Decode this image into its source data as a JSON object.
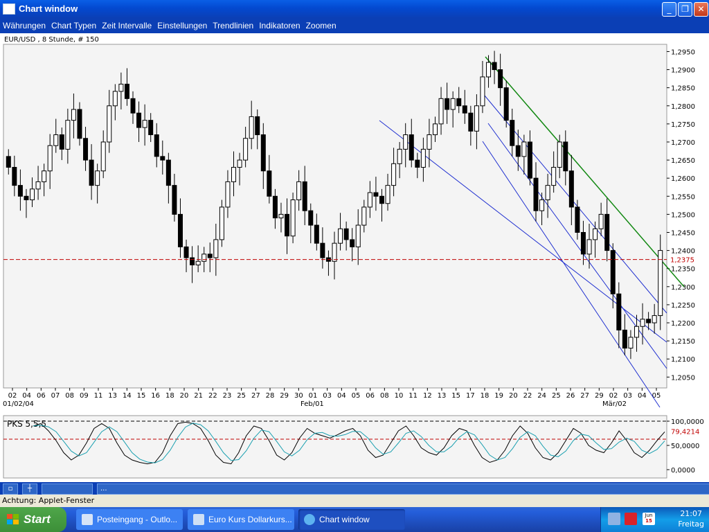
{
  "window": {
    "title": "Chart window"
  },
  "menu": [
    "Währungen",
    "Chart Typen",
    "Zeit Intervalle",
    "Einstellungen",
    "Trendlinien",
    "Indikatoren",
    "Zoomen"
  ],
  "chart_data": {
    "type": "candlestick",
    "title": "EUR/USD , 8 Stunde, # 150",
    "ylim": [
      1.202,
      1.297
    ],
    "y_ticks": [
      "1,2950",
      "1,2900",
      "1,2850",
      "1,2800",
      "1,2750",
      "1,2700",
      "1,2650",
      "1,2600",
      "1,2550",
      "1,2500",
      "1,2450",
      "1,2400",
      "1,2350",
      "1,2300",
      "1,2250",
      "1,2200",
      "1,2150",
      "1,2100",
      "1,2050"
    ],
    "x_ticks": [
      "02",
      "04",
      "06",
      "07",
      "08",
      "09",
      "11",
      "13",
      "14",
      "15",
      "16",
      "18",
      "20",
      "21",
      "22",
      "23",
      "25",
      "27",
      "28",
      "29",
      "30",
      "01",
      "03",
      "04",
      "05",
      "06",
      "08",
      "10",
      "11",
      "12",
      "13",
      "15",
      "17",
      "18",
      "19",
      "20",
      "22",
      "24",
      "25",
      "26",
      "27",
      "29",
      "02",
      "03",
      "04",
      "05"
    ],
    "x_date_labels": [
      "01/02/04",
      "Feb/01",
      "Mär/02"
    ],
    "current_price_label": "1,2375",
    "current_price": 1.2375,
    "closes": [
      1.263,
      1.258,
      1.255,
      1.254,
      1.257,
      1.259,
      1.262,
      1.269,
      1.272,
      1.268,
      1.276,
      1.279,
      1.271,
      1.265,
      1.258,
      1.262,
      1.27,
      1.28,
      1.284,
      1.286,
      1.282,
      1.278,
      1.274,
      1.276,
      1.272,
      1.266,
      1.265,
      1.258,
      1.25,
      1.241,
      1.238,
      1.236,
      1.237,
      1.239,
      1.238,
      1.243,
      1.252,
      1.259,
      1.263,
      1.265,
      1.271,
      1.277,
      1.272,
      1.262,
      1.255,
      1.249,
      1.25,
      1.244,
      1.254,
      1.259,
      1.251,
      1.247,
      1.242,
      1.238,
      1.237,
      1.242,
      1.246,
      1.243,
      1.241,
      1.247,
      1.252,
      1.256,
      1.255,
      1.253,
      1.258,
      1.264,
      1.268,
      1.272,
      1.265,
      1.263,
      1.268,
      1.272,
      1.275,
      1.282,
      1.279,
      1.282,
      1.28,
      1.278,
      1.273,
      1.28,
      1.288,
      1.292,
      1.29,
      1.285,
      1.276,
      1.269,
      1.266,
      1.27,
      1.26,
      1.251,
      1.254,
      1.258,
      1.263,
      1.27,
      1.262,
      1.252,
      1.245,
      1.239,
      1.243,
      1.246,
      1.25,
      1.24,
      1.228,
      1.218,
      1.213,
      1.216,
      1.219,
      1.221,
      1.22,
      1.222,
      1.24
    ],
    "annotations": [
      "blue downward trend channel",
      "green resistance trendline",
      "red dashed current price line"
    ]
  },
  "indicator": {
    "label": "PKS 5,5,5",
    "y_ticks": [
      "100,0000",
      "50,0000",
      "0,0000"
    ],
    "current_value_label": "79,4214",
    "current_value": 79.4214,
    "ylim": [
      0,
      100
    ],
    "k_values": [
      90,
      95,
      80,
      60,
      35,
      20,
      30,
      55,
      85,
      95,
      85,
      55,
      30,
      20,
      15,
      12,
      15,
      35,
      70,
      95,
      98,
      95,
      85,
      60,
      30,
      15,
      12,
      35,
      70,
      90,
      85,
      60,
      30,
      20,
      35,
      65,
      85,
      75,
      70,
      65,
      72,
      80,
      85,
      70,
      40,
      25,
      30,
      55,
      80,
      90,
      70,
      45,
      35,
      30,
      45,
      70,
      85,
      80,
      50,
      25,
      15,
      20,
      40,
      70,
      90,
      75,
      45,
      25,
      20,
      35,
      60,
      85,
      75,
      50,
      40,
      35,
      55,
      80,
      60,
      35,
      25,
      40,
      60,
      78
    ]
  },
  "toolbar": {
    "ellipsis": "..."
  },
  "statusbar": {
    "text": "Achtung: Applet-Fenster"
  },
  "taskbar": {
    "start": "Start",
    "tasks": [
      "Posteingang - Outlo...",
      "Euro Kurs Dollarkurs...",
      "Chart window"
    ],
    "clock_time": "21:07",
    "clock_day": "Freitag",
    "calendar_month": "Jun",
    "calendar_day": "15"
  }
}
